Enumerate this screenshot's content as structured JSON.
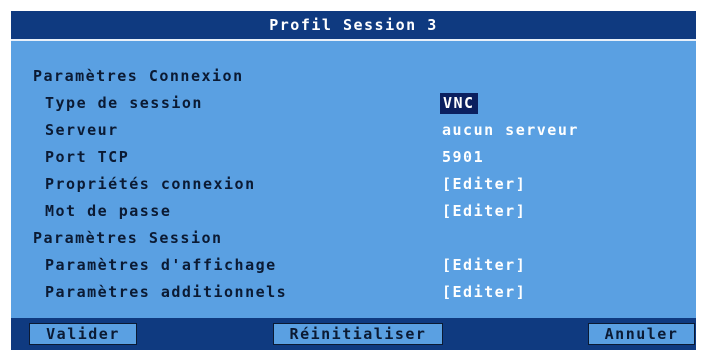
{
  "window": {
    "title": "Profil Session 3"
  },
  "sections": {
    "connexion": "Paramètres Connexion",
    "session": "Paramètres Session"
  },
  "fields": [
    {
      "label": "Type de session",
      "value": "VNC",
      "selected": true
    },
    {
      "label": "Serveur",
      "value": "aucun serveur"
    },
    {
      "label": "Port TCP",
      "value": "5901"
    },
    {
      "label": "Propriétés connexion",
      "value": "[Editer]"
    },
    {
      "label": "Mot de passe",
      "value": "[Editer]"
    },
    {
      "label": "Paramètres d'affichage",
      "value": "[Editer]"
    },
    {
      "label": "Paramètres additionnels",
      "value": "[Editer]"
    }
  ],
  "buttons": {
    "validate": "Valider",
    "reset": "Réinitialiser",
    "cancel": "Annuler"
  },
  "colors": {
    "background": "#5aa0e2",
    "title_bar": "#0f3a80",
    "text_dark": "#0b1a33",
    "text_light": "#ffffff",
    "selection": "#0b2060"
  }
}
